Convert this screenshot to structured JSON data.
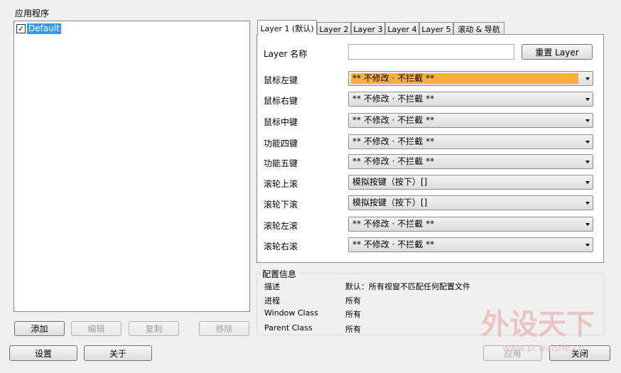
{
  "app_section": {
    "title": "应用程序",
    "items": [
      {
        "label": "Default",
        "checked": true
      }
    ]
  },
  "list_buttons": {
    "add": "添加",
    "edit": "编辑",
    "copy": "复制",
    "remove": "移除"
  },
  "tabs": [
    {
      "label": "Layer 1 (默认)",
      "active": true
    },
    {
      "label": "Layer 2",
      "active": false
    },
    {
      "label": "Layer 3",
      "active": false
    },
    {
      "label": "Layer 4",
      "active": false
    },
    {
      "label": "Layer 5",
      "active": false
    },
    {
      "label": "滚动 & 导航",
      "active": false
    }
  ],
  "layer": {
    "name_label": "Layer 名称",
    "name_value": "",
    "reset_button": "重置 Layer",
    "mappings": [
      {
        "label": "鼠标左键",
        "value": "** 不修改 · 不拦截 **",
        "focused": true
      },
      {
        "label": "鼠标右键",
        "value": "** 不修改 · 不拦截 **",
        "focused": false
      },
      {
        "label": "鼠标中键",
        "value": "** 不修改 · 不拦截 **",
        "focused": false
      },
      {
        "label": "功能四键",
        "value": "** 不修改 · 不拦截 **",
        "focused": false
      },
      {
        "label": "功能五键",
        "value": "** 不修改 · 不拦截 **",
        "focused": false
      },
      {
        "label": "滚轮上滚",
        "value": "模拟按键（按下）[]",
        "focused": false
      },
      {
        "label": "滚轮下滚",
        "value": "模拟按键（按下）[]",
        "focused": false
      },
      {
        "label": "滚轮左滚",
        "value": "** 不修改 · 不拦截 **",
        "focused": false
      },
      {
        "label": "滚轮右滚",
        "value": "** 不修改 · 不拦截 **",
        "focused": false
      }
    ]
  },
  "config_info": {
    "title": "配置信息",
    "rows": [
      {
        "key": "描述",
        "value": "默认：所有视窗不匹配任何配置文件"
      },
      {
        "key": "进程",
        "value": "所有"
      },
      {
        "key": "Window Class",
        "value": "所有"
      },
      {
        "key": "Parent Class",
        "value": "所有"
      }
    ]
  },
  "bottom_buttons": {
    "settings": "设置",
    "about": "关于",
    "apply": "应用",
    "close": "关闭"
  },
  "watermark": {
    "text": "外设天下",
    "url": "www.pcwaishe.cn",
    "color": "#e8b4b4"
  },
  "colors": {
    "selection": "#3399ff",
    "focused_combo": "#f9b233"
  }
}
